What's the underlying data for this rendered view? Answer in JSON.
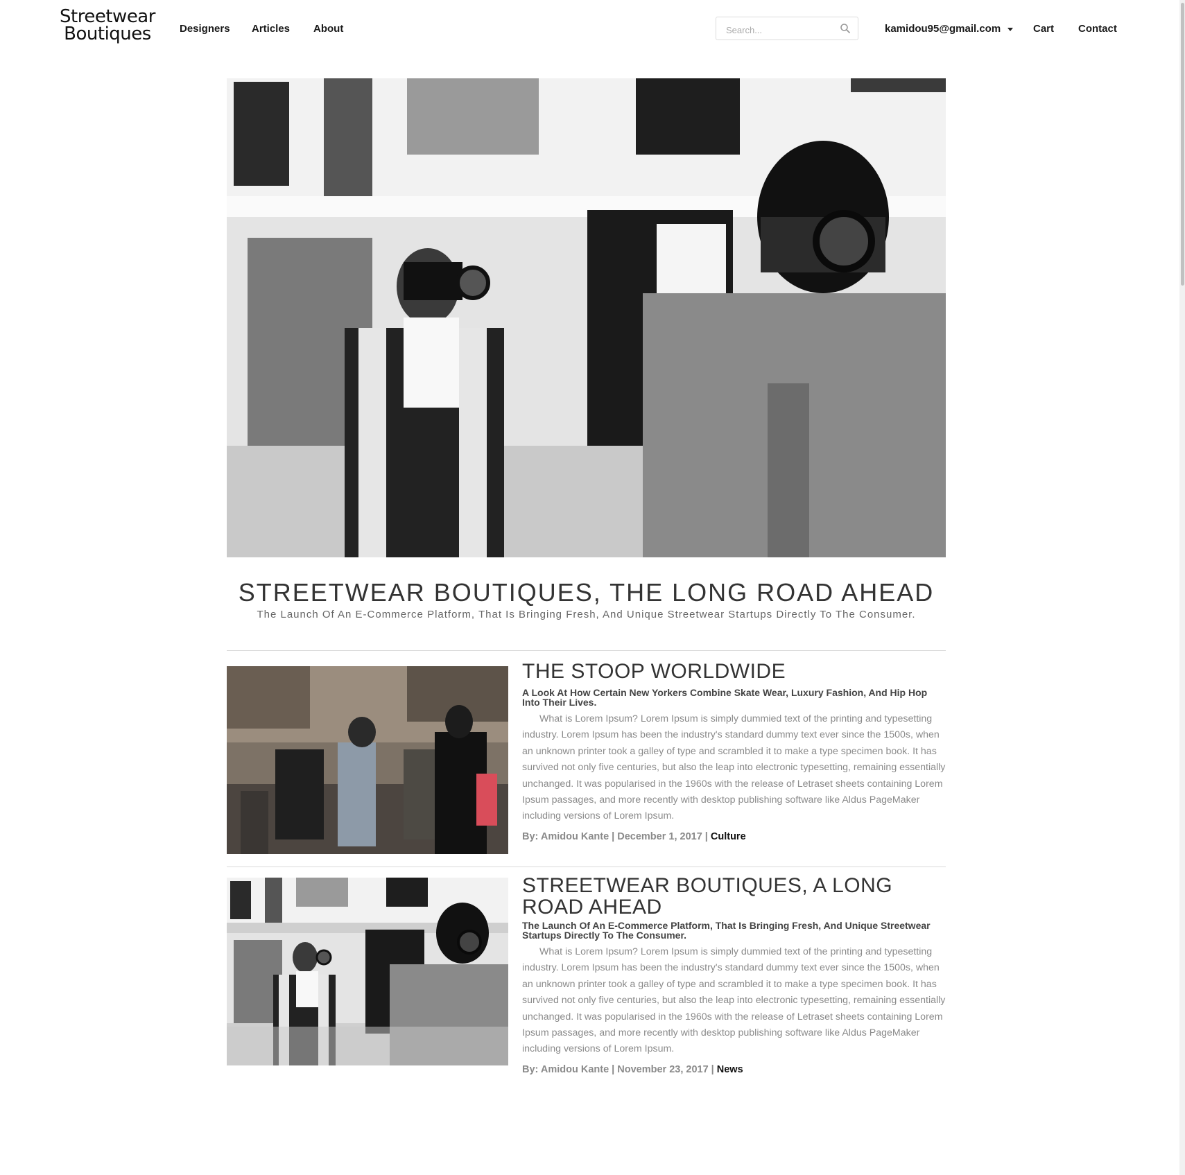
{
  "header": {
    "logo_line1": "Streetwear",
    "logo_line2": "Boutiques",
    "nav": [
      "Designers",
      "Articles",
      "About"
    ],
    "search_placeholder": "Search...",
    "user_email": "kamidou95@gmail.com",
    "cart_label": "Cart",
    "contact_label": "Contact"
  },
  "hero": {
    "title": "STREETWEAR BOUTIQUES, THE LONG ROAD AHEAD",
    "subtitle": "The Launch Of An E-Commerce Platform, That Is Bringing Fresh, And Unique Streetwear Startups Directly To The Consumer."
  },
  "articles": [
    {
      "title": "THE STOOP WORLDWIDE",
      "subtitle": "A Look At How Certain New Yorkers Combine Skate Wear, Luxury Fashion, And Hip Hop Into Their Lives.",
      "body": "What is Lorem Ipsum? Lorem Ipsum is simply dummied text of the printing and typesetting industry. Lorem Ipsum has been the industry's standard dummy text ever since the 1500s, when an unknown printer took a galley of type and scrambled it to make a type specimen book. It has survived not only five centuries, but also the leap into electronic typesetting, remaining essentially unchanged. It was popularised in the 1960s with the release of Letraset sheets containing Lorem Ipsum passages, and more recently with desktop publishing software like Aldus PageMaker including versions of Lorem Ipsum.",
      "meta": "By: Amidou Kante | December 1, 2017 | ",
      "category": "Culture"
    },
    {
      "title": "STREETWEAR BOUTIQUES, A LONG ROAD AHEAD",
      "subtitle": "The Launch Of An E-Commerce Platform, That Is Bringing Fresh, And Unique Streetwear Startups Directly To The Consumer.",
      "body": "What is Lorem Ipsum? Lorem Ipsum is simply dummied text of the printing and typesetting industry. Lorem Ipsum has been the industry's standard dummy text ever since the 1500s, when an unknown printer took a galley of type and scrambled it to make a type specimen book. It has survived not only five centuries, but also the leap into electronic typesetting, remaining essentially unchanged. It was popularised in the 1960s with the release of Letraset sheets containing Lorem Ipsum passages, and more recently with desktop publishing software like Aldus PageMaker including versions of Lorem Ipsum.",
      "meta": "By: Amidou Kante | November 23, 2017 | ",
      "category": "News"
    }
  ],
  "colors": {
    "text_dark": "#1a1a1a",
    "text_muted": "#8a8a8a",
    "divider": "#d8d8d8"
  }
}
